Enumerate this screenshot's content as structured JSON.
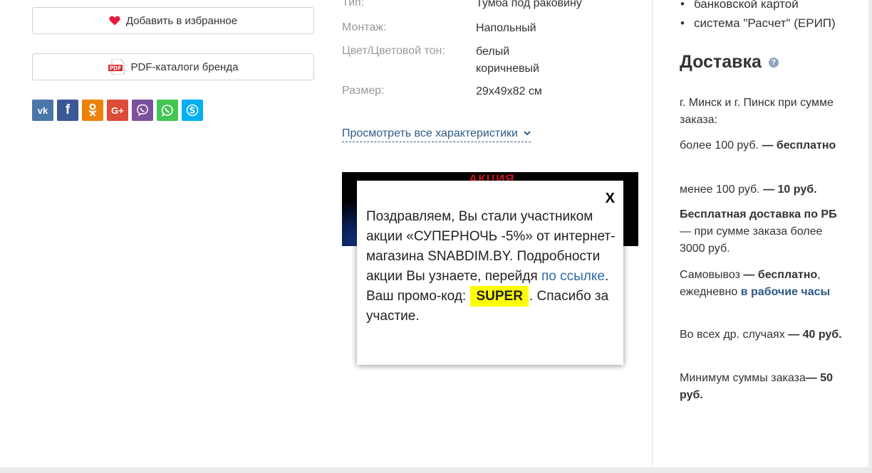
{
  "left": {
    "favorites_label": "Добавить в избранное",
    "pdf_label": "PDF-каталоги бренда",
    "pdf_icon_text": "PDF",
    "social": [
      {
        "name": "vk",
        "glyph": "vk",
        "color": "#4a76a8"
      },
      {
        "name": "facebook",
        "glyph": "f",
        "color": "#3b5998"
      },
      {
        "name": "odnoklassniki",
        "glyph": "ок",
        "color": "#ee8208"
      },
      {
        "name": "google-plus",
        "glyph": "G+",
        "color": "#dd4b39"
      },
      {
        "name": "viber",
        "glyph": "✆",
        "color": "#7b519d"
      },
      {
        "name": "whatsapp",
        "glyph": "✆",
        "color": "#43c553"
      },
      {
        "name": "skype",
        "glyph": "S",
        "color": "#00aff0"
      }
    ]
  },
  "specs": {
    "rows": [
      {
        "label": "Тип:",
        "value": [
          "Тумба под раковину"
        ]
      },
      {
        "label": "Монтаж:",
        "value": [
          "Напольный"
        ]
      },
      {
        "label": "Цвет/Цветовой тон:",
        "value": [
          "белый",
          "коричневый"
        ]
      },
      {
        "label": "Размер:",
        "value": [
          "29х49х82 см"
        ]
      }
    ],
    "all_specs_link": "Просмотреть все характеристики"
  },
  "banner": {
    "text": "АКЦИЯ"
  },
  "popup": {
    "close_label": "X",
    "text_before": "Поздравляем, Вы стали участником акции «СУПЕРНОЧЬ -5%» от интернет-магазина SNABDIM.BY. Подробности акции Вы узнаете, перейдя ",
    "link_text": "по ссылке",
    "text_middle": ". Ваш промо-код: ",
    "promo_code": "SUPER",
    "text_after": ". Спасибо за участие."
  },
  "right": {
    "payment_items": [
      "банковской картой",
      "система \"Расчет\" (ЕРИП)"
    ],
    "delivery_title": "Доставка",
    "help_icon": "?",
    "intro": "г. Минск и г. Пинск при сумме заказа:",
    "over_100": {
      "text": "более 100 руб. ",
      "dash": "— ",
      "bold": "бесплатно"
    },
    "under_100": {
      "text": "менее 100 руб. ",
      "bold": "— 10 руб."
    },
    "free_rb": {
      "bold": "Бесплатная доставка по РБ",
      "text": " — при сумме заказа более 3000 руб."
    },
    "pickup": {
      "text": "Самовывоз ",
      "bold": "— бесплатно",
      "text2": ", ежедневно ",
      "link": "в рабочие часы"
    },
    "other": {
      "text": "Во всех др. случаях ",
      "bold": "— 40 руб."
    },
    "minimum": {
      "text": "Минимум суммы заказа",
      "bold": "— 50 руб."
    }
  }
}
